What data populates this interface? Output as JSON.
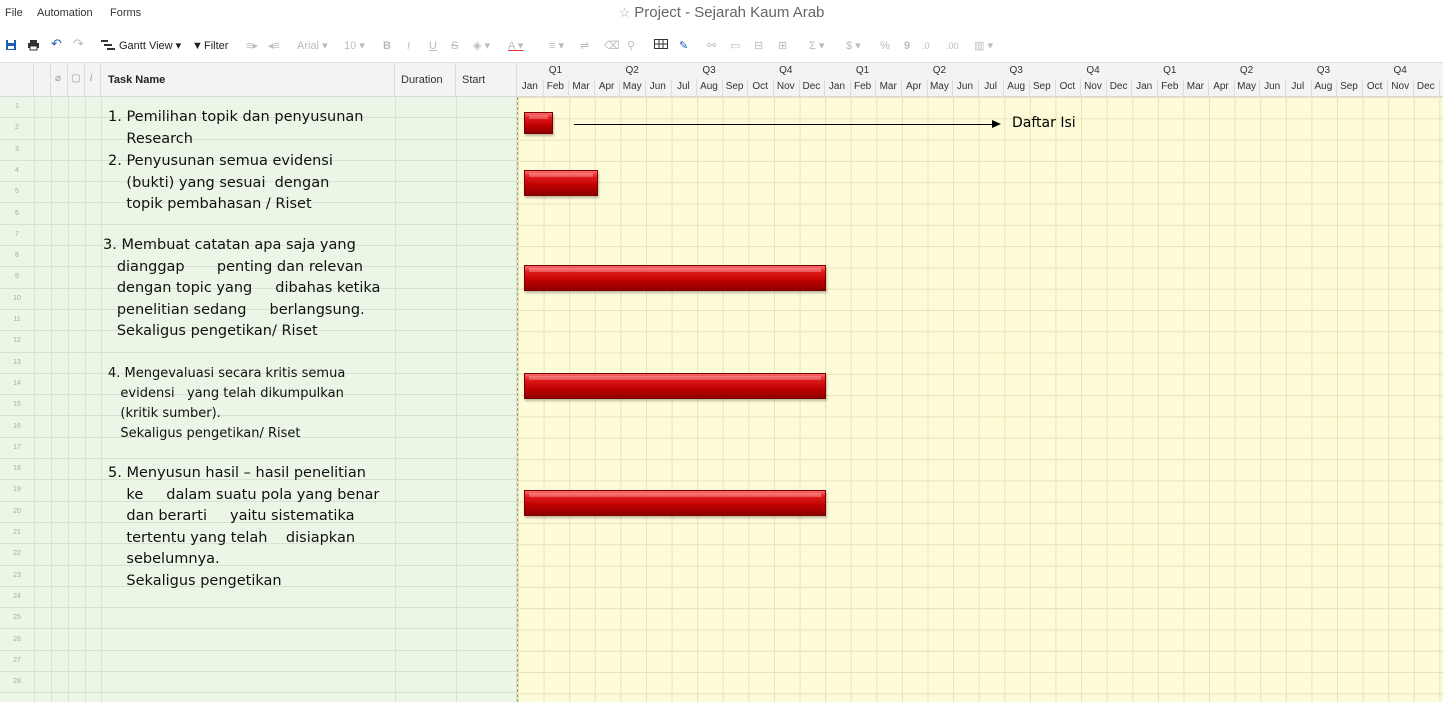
{
  "menu": {
    "file": "File",
    "automation": "Automation",
    "forms": "Forms"
  },
  "title": "Project - Sejarah Kaum Arab",
  "toolbar": {
    "view": "Gantt View",
    "filter": "Filter",
    "font": "Arial",
    "size": "10",
    "bold": "B",
    "italic": "I",
    "underline": "U",
    "strike": "S",
    "sum": "Σ",
    "dollar": "$",
    "percent": "%",
    "comma": "9",
    "dec_less": ".0",
    "dec_more": ".00"
  },
  "columns": {
    "task": "Task Name",
    "duration": "Duration",
    "start": "Start"
  },
  "quarters": [
    "Q1",
    "Q2",
    "Q3",
    "Q4",
    "Q1",
    "Q2",
    "Q3",
    "Q4",
    "Q1",
    "Q2",
    "Q3",
    "Q4"
  ],
  "months": [
    "Jan",
    "Feb",
    "Mar",
    "Apr",
    "May",
    "Jun",
    "Jul",
    "Aug",
    "Sep",
    "Oct",
    "Nov",
    "Dec",
    "Jan",
    "Feb",
    "Mar",
    "Apr",
    "May",
    "Jun",
    "Jul",
    "Aug",
    "Sep",
    "Oct",
    "Nov",
    "Dec",
    "Jan",
    "Feb",
    "Mar",
    "Apr",
    "May",
    "Jun",
    "Jul",
    "Aug",
    "Sep",
    "Oct",
    "Nov",
    "Dec"
  ],
  "rows": [
    "1",
    "2",
    "3",
    "4",
    "5",
    "6",
    "7",
    "8",
    "9",
    "10",
    "11",
    "12",
    "13",
    "14",
    "15",
    "16",
    "17",
    "18",
    "19",
    "20",
    "21",
    "22",
    "23",
    "24",
    "25",
    "26",
    "27",
    "28"
  ],
  "tasks": {
    "t1": [
      "1. Pemilihan topik dan penyusunan",
      "    Research"
    ],
    "t2": [
      "2. Penyusunan semua evidensi",
      "    (bukti) yang sesuai  dengan",
      "    topik pembahasan / Riset"
    ],
    "t3": [
      "3. Membuat catatan apa saja yang",
      "   dianggap       penting dan relevan",
      "   dengan topic yang     dibahas ketika",
      "   penelitian sedang     berlangsung.",
      "   Sekaligus pengetikan/ Riset"
    ],
    "t4": [
      "4. Mengevaluasi secara kritis semua",
      "   evidensi   yang telah dikumpulkan",
      "   (kritik sumber).",
      "   Sekaligus pengetikan/ Riset"
    ],
    "t5": [
      "5. Menyusun hasil – hasil penelitian",
      "    ke     dalam suatu pola yang benar",
      "    dan berarti     yaitu sistematika",
      "    tertentu yang telah    disiapkan",
      "    sebelumnya.",
      "    Sekaligus pengetikan"
    ]
  },
  "annotation": "Daftar Isi",
  "colors": {
    "bar": "#c00000",
    "gantt_bg": "#fdfbd8",
    "grid_bg": "#ecf6e6"
  }
}
